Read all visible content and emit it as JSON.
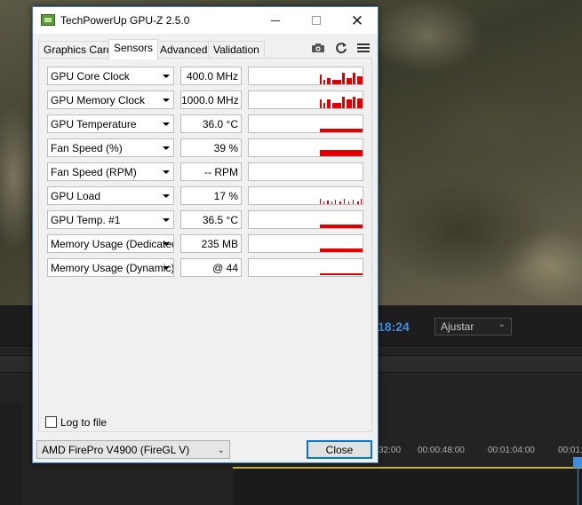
{
  "background_app": {
    "timecode": "18:24",
    "fit_dropdown": "Ajustar",
    "ruler_labels": [
      "32:00",
      "00:00:48:00",
      "00:01:04:00",
      "00:01:"
    ]
  },
  "window": {
    "title": "TechPowerUp GPU-Z 2.5.0",
    "controls": {
      "minimize": "minimize",
      "maximize": "maximize",
      "close": "close"
    },
    "tabs": [
      {
        "label": "Graphics Card",
        "active": false
      },
      {
        "label": "Sensors",
        "active": true
      },
      {
        "label": "Advanced",
        "active": false
      },
      {
        "label": "Validation",
        "active": false
      }
    ],
    "toolbar_icons": [
      "camera-icon",
      "refresh-icon",
      "menu-icon"
    ],
    "sensors": [
      {
        "name": "GPU Core Clock",
        "value": "400.0 MHz",
        "graph": "spiky"
      },
      {
        "name": "GPU Memory Clock",
        "value": "1000.0 MHz",
        "graph": "spiky-high"
      },
      {
        "name": "GPU Temperature",
        "value": "36.0 °C",
        "graph": "flat"
      },
      {
        "name": "Fan Speed (%)",
        "value": "39 %",
        "graph": "flat-thick"
      },
      {
        "name": "Fan Speed (RPM)",
        "value": "-- RPM",
        "graph": "none"
      },
      {
        "name": "GPU Load",
        "value": "17 %",
        "graph": "sparse"
      },
      {
        "name": "GPU Temp. #1",
        "value": "36.5 °C",
        "graph": "flat"
      },
      {
        "name": "Memory Usage (Dedicated)",
        "value": "235 MB",
        "graph": "flat"
      },
      {
        "name": "Memory Usage (Dynamic)",
        "value": "@ 44",
        "graph": "thin"
      }
    ],
    "log_to_file": {
      "label": "Log to file",
      "checked": false
    },
    "gpu_select": {
      "value": "AMD FirePro V4900 (FireGL V)"
    },
    "close_button": "Close",
    "graph_color": "#e00000"
  }
}
